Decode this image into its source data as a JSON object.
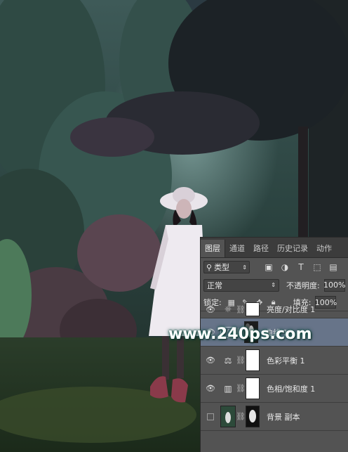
{
  "panel": {
    "tabs": [
      {
        "label": "图层",
        "active": true
      },
      {
        "label": "通道",
        "active": false
      },
      {
        "label": "路径",
        "active": false
      },
      {
        "label": "历史记录",
        "active": false
      },
      {
        "label": "动作",
        "active": false
      }
    ],
    "filter_label": "类型",
    "filter_icons": [
      "image-filter-icon",
      "adjustment-filter-icon",
      "type-filter-icon",
      "shape-filter-icon",
      "smart-object-filter-icon"
    ],
    "blend_mode": "正常",
    "opacity_label": "不透明度:",
    "opacity_value": "100%",
    "lock_label": "锁定:",
    "fill_label": "填充:",
    "fill_value": "100%",
    "layers": [
      {
        "name": "亮度/对比度 1",
        "visible": true,
        "type": "brightness-contrast",
        "selected": false
      },
      {
        "name": "曲线 1",
        "visible": true,
        "type": "curves",
        "selected": true
      },
      {
        "name": "色彩平衡 1",
        "visible": true,
        "type": "color-balance",
        "selected": false
      },
      {
        "name": "色相/饱和度 1",
        "visible": true,
        "type": "hue-saturation",
        "selected": false
      },
      {
        "name": "背景 副本",
        "visible": false,
        "type": "image",
        "selected": false
      }
    ]
  },
  "watermark": "www.240ps.com",
  "colors": {
    "panel_bg": "#535353",
    "tab_bar_bg": "#3c3c3c",
    "selected_row": "#677489",
    "watermark_glow": "#1f6c5f"
  }
}
